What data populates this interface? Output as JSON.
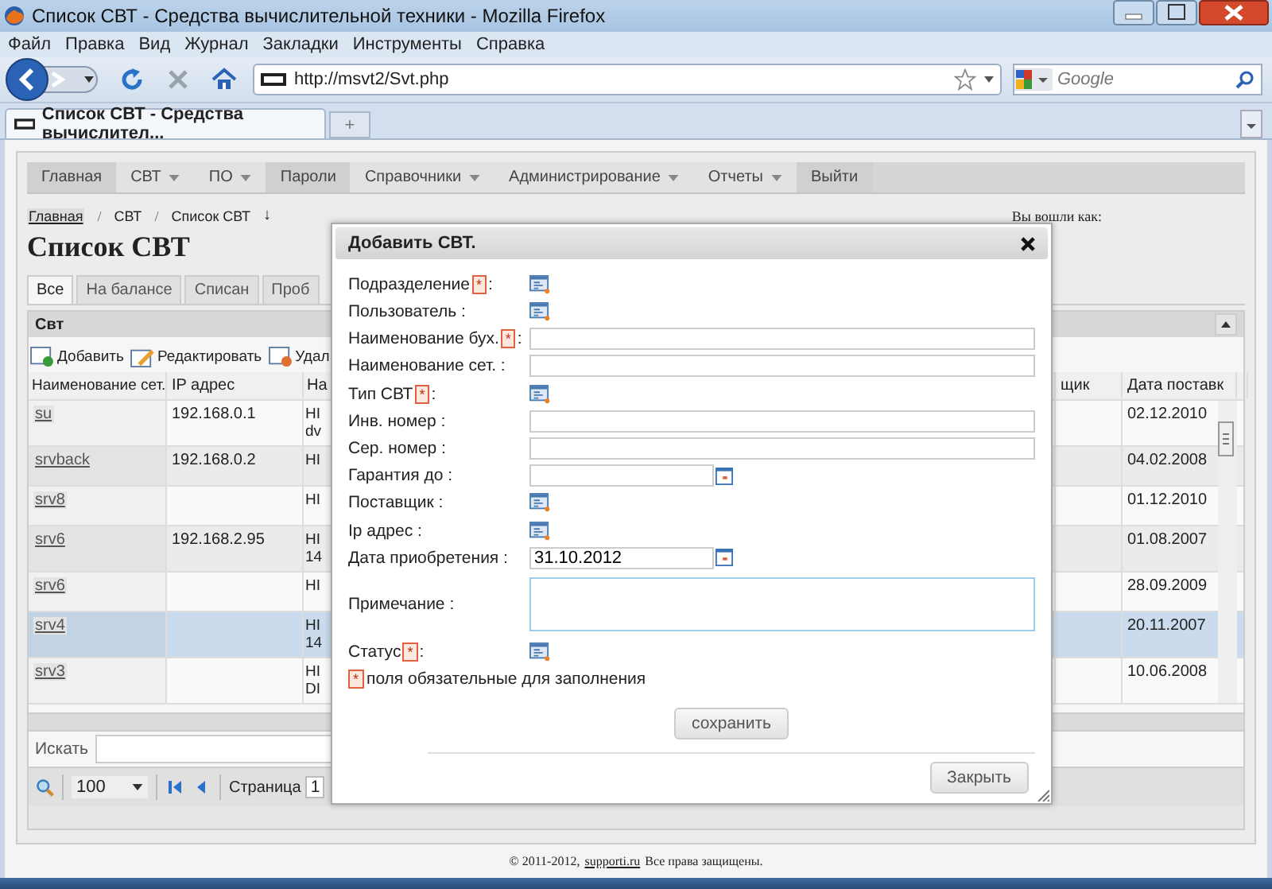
{
  "window": {
    "title": "Список СВТ - Средства вычислительной техники - Mozilla Firefox"
  },
  "menu_bar": [
    "Файл",
    "Правка",
    "Вид",
    "Журнал",
    "Закладки",
    "Инструменты",
    "Справка"
  ],
  "address_bar": {
    "value": "http://msvt2/Svt.php"
  },
  "search_field": {
    "placeholder": "Google"
  },
  "browser_tabs": [
    {
      "label": "Список СВТ - Средства вычислител...",
      "selected": true
    }
  ],
  "new_tab": "+",
  "nav_menu": [
    {
      "label": "Главная",
      "dropdown": false,
      "selected": true
    },
    {
      "label": "СВТ",
      "dropdown": true,
      "selected": false
    },
    {
      "label": "ПО",
      "dropdown": true,
      "selected": false
    },
    {
      "label": "Пароли",
      "dropdown": false,
      "selected": true
    },
    {
      "label": "Справочники",
      "dropdown": true,
      "selected": false
    },
    {
      "label": "Администрирование",
      "dropdown": true,
      "selected": false
    },
    {
      "label": "Отчеты",
      "dropdown": true,
      "selected": false
    },
    {
      "label": "Выйти",
      "dropdown": false,
      "selected": true
    }
  ],
  "breadcrumb": [
    "Главная",
    "СВТ",
    "Список СВТ"
  ],
  "breadcrumb_separator": "/",
  "sort_mark": "↓",
  "login_label": "Вы вошли как:",
  "page_title": "Список СВТ",
  "page_tabs": [
    {
      "label": "Все",
      "selected": true
    },
    {
      "label": "На балансе",
      "selected": false
    },
    {
      "label": "Списан",
      "selected": false
    },
    {
      "label": "Проб",
      "selected": false
    }
  ],
  "grid": {
    "caption": "Свт",
    "toolbar": [
      {
        "label": "Добавить",
        "kind": "add"
      },
      {
        "label": "Редактировать",
        "kind": "edit"
      },
      {
        "label": "Удал",
        "kind": "delete"
      }
    ],
    "columns": [
      "Наименование сет.",
      "IP адрес",
      "На",
      "щик",
      "Дата поставк"
    ],
    "rows": [
      {
        "name": "su",
        "ip": "192.168.0.1",
        "column_3": [
          "HI",
          "dv"
        ],
        "date": "02.12.2010",
        "selected": false
      },
      {
        "name": "srvback",
        "ip": "192.168.0.2",
        "column_3": [
          "HI"
        ],
        "date": "04.02.2008",
        "selected": false
      },
      {
        "name": "srv8",
        "ip": "",
        "column_3": [
          "HI"
        ],
        "date": "01.12.2010",
        "selected": false
      },
      {
        "name": "srv6",
        "ip": "192.168.2.95",
        "column_3": [
          "HI",
          "14"
        ],
        "date": "01.08.2007",
        "selected": false
      },
      {
        "name": "srv6",
        "ip": "",
        "column_3": [
          "HI"
        ],
        "date": "28.09.2009",
        "selected": false
      },
      {
        "name": "srv4",
        "ip": "",
        "column_3": [
          "HI",
          "14"
        ],
        "date": "20.11.2007",
        "selected": true
      },
      {
        "name": "srv3",
        "ip": "",
        "column_3": [
          "HI",
          "DI"
        ],
        "date": "10.06.2008",
        "selected": false
      }
    ],
    "search_label": "Искать",
    "page_size": "100",
    "page_label": "Страница",
    "page_value": "1"
  },
  "footer": {
    "prefix": "© 2011-2012,",
    "link": "supporti.ru",
    "suffix": "Все права защищены."
  },
  "dialog": {
    "title": "Добавить СВТ.",
    "fields": [
      {
        "label": "Подразделение",
        "required": true,
        "kind": "lookup"
      },
      {
        "label": "Пользователь :",
        "required": false,
        "kind": "lookup"
      },
      {
        "label": "Наименование бух.",
        "required": true,
        "kind": "text"
      },
      {
        "label": "Наименование сет. :",
        "required": false,
        "kind": "text"
      },
      {
        "label": "Тип СВТ",
        "required": true,
        "kind": "lookup"
      },
      {
        "label": "Инв. номер :",
        "required": false,
        "kind": "text"
      },
      {
        "label": "Сер. номер :",
        "required": false,
        "kind": "text"
      },
      {
        "label": "Гарантия до :",
        "required": false,
        "kind": "date"
      },
      {
        "label": "Поставщик :",
        "required": false,
        "kind": "lookup"
      },
      {
        "label": "Ip адрес :",
        "required": false,
        "kind": "lookup"
      },
      {
        "label": "Дата приобретения :",
        "required": false,
        "kind": "date",
        "value": "31.10.2012"
      },
      {
        "label": "Примечание :",
        "required": false,
        "kind": "textarea"
      },
      {
        "label": "Статус",
        "required": true,
        "kind": "lookup"
      }
    ],
    "required_mark": "*",
    "required_colon": ":",
    "required_note": "поля обязательные для заполнения",
    "save": "сохранить",
    "close": "Закрыть"
  }
}
